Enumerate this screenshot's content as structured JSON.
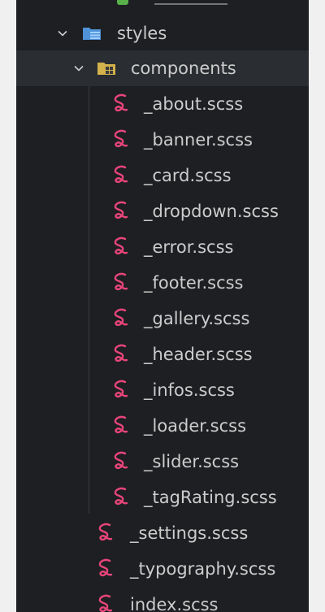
{
  "tree": {
    "styles_folder": {
      "label": "styles",
      "icon": "folder-styles-icon"
    },
    "components_folder": {
      "label": "components",
      "icon": "folder-components-icon"
    },
    "components_files": [
      {
        "label": "_about.scss",
        "icon": "sass-icon"
      },
      {
        "label": "_banner.scss",
        "icon": "sass-icon"
      },
      {
        "label": "_card.scss",
        "icon": "sass-icon"
      },
      {
        "label": "_dropdown.scss",
        "icon": "sass-icon"
      },
      {
        "label": "_error.scss",
        "icon": "sass-icon"
      },
      {
        "label": "_footer.scss",
        "icon": "sass-icon"
      },
      {
        "label": "_gallery.scss",
        "icon": "sass-icon"
      },
      {
        "label": "_header.scss",
        "icon": "sass-icon"
      },
      {
        "label": "_infos.scss",
        "icon": "sass-icon"
      },
      {
        "label": "_loader.scss",
        "icon": "sass-icon"
      },
      {
        "label": "_slider.scss",
        "icon": "sass-icon"
      },
      {
        "label": "_tagRating.scss",
        "icon": "sass-icon"
      }
    ],
    "styles_files": [
      {
        "label": "_settings.scss",
        "icon": "sass-icon"
      },
      {
        "label": "_typography.scss",
        "icon": "sass-icon"
      },
      {
        "label": "index.scss",
        "icon": "sass-icon"
      }
    ]
  },
  "colors": {
    "background": "#1e1f22",
    "selected_row": "#2a2d31",
    "text": "#cccccc",
    "sass_pink": "#e8457a",
    "folder_blue": "#4f93d8",
    "folder_yellow": "#d4b24c"
  }
}
